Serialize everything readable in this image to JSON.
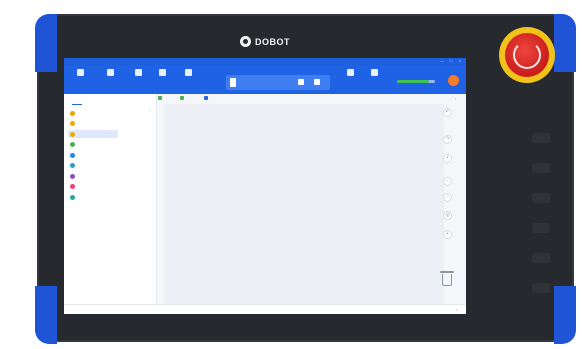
{
  "device": {
    "brand": "DOBOT",
    "accent_color": "#1f54d6",
    "estop_color": "#d62626"
  },
  "app": {
    "title": "",
    "controls": [
      "—",
      "□",
      "×"
    ]
  },
  "toolbar": {
    "tools": [
      {
        "label": "",
        "icon": "connect-icon"
      },
      {
        "label": "",
        "icon": "robot-icon"
      },
      {
        "label": "",
        "icon": "script-icon"
      },
      {
        "label": "",
        "icon": "teach-icon"
      },
      {
        "label": "",
        "icon": "program-icon"
      }
    ],
    "ip_text": "",
    "right_tools": [
      {
        "label": "",
        "icon": "enable-icon"
      },
      {
        "label": "",
        "icon": "switch-icon"
      }
    ],
    "speed_label": "",
    "speed_fraction": 0.85,
    "power_icon": "power-icon"
  },
  "left_panel": {
    "tabs": [
      {
        "label": "",
        "active": true
      },
      {
        "label": "",
        "active": false
      }
    ],
    "blocks": [
      {
        "label": "",
        "color": "#f0a500"
      },
      {
        "label": "",
        "color": "#f0a500"
      },
      {
        "label": "",
        "color": "#f0a500",
        "selected": true
      },
      {
        "label": "",
        "color": "#4caf50"
      },
      {
        "label": "",
        "color": "#1e88e5"
      },
      {
        "label": "",
        "color": "#26a0c7"
      },
      {
        "label": "",
        "color": "#7e57c2"
      },
      {
        "label": "",
        "color": "#ec407a"
      },
      {
        "label": "",
        "color": "#26a69a"
      }
    ]
  },
  "center": {
    "tabs": [
      {
        "label": "",
        "color": "#4caf50"
      },
      {
        "label": "",
        "color": "#4caf50"
      },
      {
        "label": "",
        "color": "#2463e6"
      }
    ]
  },
  "right_panel": {
    "tools": [
      {
        "icon": "undo-icon",
        "glyph": "↶"
      },
      {
        "icon": "redo-icon",
        "glyph": "↷"
      },
      {
        "icon": "zoom-in-icon",
        "glyph": "+"
      },
      {
        "icon": "zoom-out-icon",
        "glyph": "−"
      },
      {
        "icon": "fit-icon",
        "glyph": "○"
      },
      {
        "icon": "center-icon",
        "glyph": "◎"
      },
      {
        "icon": "add-icon",
        "glyph": "+"
      }
    ]
  },
  "status": {
    "left": "",
    "right": "",
    "arrow": "›"
  }
}
